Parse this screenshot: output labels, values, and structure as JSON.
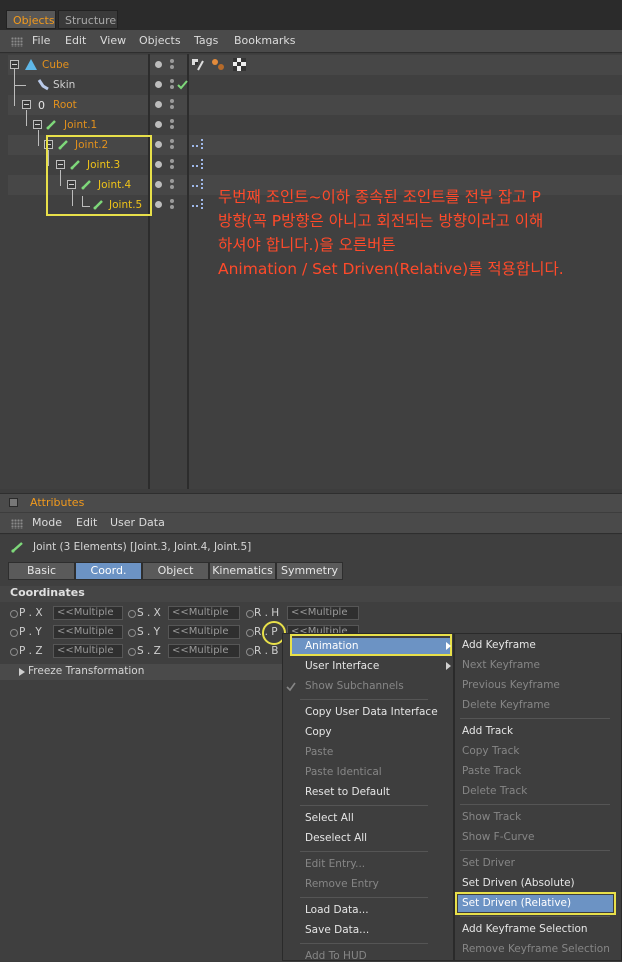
{
  "tabs": [
    {
      "label": "Objects",
      "active": true
    },
    {
      "label": "Structure",
      "active": false
    }
  ],
  "menu": [
    "File",
    "Edit",
    "View",
    "Objects",
    "Tags",
    "Bookmarks"
  ],
  "objects": [
    {
      "name": "Cube",
      "color": "orange"
    },
    {
      "name": "Skin",
      "color": "grey"
    },
    {
      "name": "Root",
      "color": "orange"
    },
    {
      "name": "Joint.1",
      "color": "orange"
    },
    {
      "name": "Joint.2",
      "color": "orange"
    },
    {
      "name": "Joint.3",
      "color": "yellow"
    },
    {
      "name": "Joint.4",
      "color": "yellow"
    },
    {
      "name": "Joint.5",
      "color": "yellow"
    }
  ],
  "annotation": {
    "line1": "두번째 조인트~이하 종속된 조인트를 전부 잡고 P",
    "line2": "방향(꼭 P방향은 아니고 회전되는 방향이라고 이해",
    "line3": "하셔야 합니다.)을 오른버튼",
    "line4": "Animation / Set Driven(Relative)를 적용합니다."
  },
  "attributes": {
    "title": "Attributes",
    "menu": [
      "Mode",
      "Edit",
      "User Data"
    ],
    "selection": "Joint (3 Elements) [Joint.3, Joint.4, Joint.5]",
    "tabs": [
      "Basic",
      "Coord.",
      "Object",
      "Kinematics",
      "Symmetry"
    ],
    "active_tab": "Coord.",
    "section": "Coordinates",
    "fields": {
      "px": "P . X",
      "py": "P . Y",
      "pz": "P . Z",
      "sx": "S . X",
      "sy": "S . Y",
      "sz": "S . Z",
      "rh": "R . H",
      "rp": "R . P",
      "rb": "R . B",
      "value": "<<Multiple Values>>",
      "value_short": "<<Multiple"
    },
    "freeze": "Freeze Transformation"
  },
  "context_menu": {
    "items": [
      {
        "label": "Animation",
        "enabled": true,
        "submenu": true,
        "selected": true
      },
      {
        "label": "User Interface",
        "enabled": true,
        "submenu": true
      },
      {
        "label": "Show Subchannels",
        "enabled": false,
        "checked": true
      },
      {
        "label": "Copy User Data Interface",
        "enabled": true
      },
      {
        "label": "Copy",
        "enabled": true
      },
      {
        "label": "Paste",
        "enabled": false
      },
      {
        "label": "Paste Identical",
        "enabled": false
      },
      {
        "label": "Reset to Default",
        "enabled": true
      },
      {
        "label": "Select All",
        "enabled": true
      },
      {
        "label": "Deselect All",
        "enabled": true
      },
      {
        "label": "Edit Entry...",
        "enabled": false
      },
      {
        "label": "Remove Entry",
        "enabled": false
      },
      {
        "label": "Load Data...",
        "enabled": true
      },
      {
        "label": "Save Data...",
        "enabled": true
      },
      {
        "label": "Add To HUD",
        "enabled": false
      }
    ]
  },
  "submenu": {
    "items": [
      {
        "label": "Add Keyframe",
        "enabled": true
      },
      {
        "label": "Next Keyframe",
        "enabled": false
      },
      {
        "label": "Previous Keyframe",
        "enabled": false
      },
      {
        "label": "Delete Keyframe",
        "enabled": false
      },
      {
        "label": "Add Track",
        "enabled": true
      },
      {
        "label": "Copy Track",
        "enabled": false
      },
      {
        "label": "Paste Track",
        "enabled": false
      },
      {
        "label": "Delete Track",
        "enabled": false
      },
      {
        "label": "Show Track",
        "enabled": false
      },
      {
        "label": "Show F-Curve",
        "enabled": false
      },
      {
        "label": "Set Driver",
        "enabled": false
      },
      {
        "label": "Set Driven (Absolute)",
        "enabled": true
      },
      {
        "label": "Set Driven (Relative)",
        "enabled": true,
        "selected": true
      },
      {
        "label": "Add Keyframe Selection",
        "enabled": true
      },
      {
        "label": "Remove Keyframe Selection",
        "enabled": false
      }
    ]
  },
  "colors": {
    "accent": "#f29a1d",
    "highlight": "#e8e04a",
    "annotation": "#ff4a2a",
    "selection": "#6c93c4"
  }
}
